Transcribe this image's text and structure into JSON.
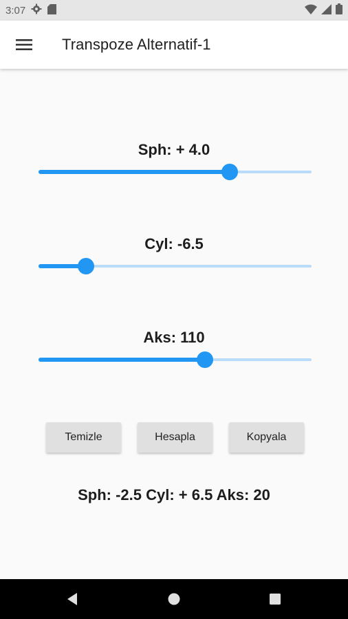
{
  "status_bar": {
    "time": "3:07",
    "left_icons": [
      "gear-icon",
      "sd-card-icon"
    ],
    "right_icons": [
      "wifi-icon",
      "signal-icon",
      "battery-icon"
    ]
  },
  "app_bar": {
    "menu_icon": "hamburger-menu-icon",
    "title": "Transpoze Alternatif-1"
  },
  "sliders": [
    {
      "id": "sph",
      "label": "Sph: + 4.0",
      "fraction": 0.7
    },
    {
      "id": "cyl",
      "label": "Cyl: -6.5",
      "fraction": 0.175
    },
    {
      "id": "aks",
      "label": "Aks: 110",
      "fraction": 0.61
    }
  ],
  "buttons": {
    "clear_label": "Temizle",
    "calculate_label": "Hesapla",
    "copy_label": "Kopyala"
  },
  "result": "Sph: -2.5 Cyl: + 6.5 Aks: 20",
  "nav_bar": {
    "icons": [
      "back-icon",
      "home-icon",
      "recents-icon"
    ]
  },
  "colors": {
    "accent": "#2196f3",
    "track_inactive": "#b9dcfa",
    "button_bg": "#e0e0e0",
    "status_bar_bg": "#e6e6e6"
  }
}
